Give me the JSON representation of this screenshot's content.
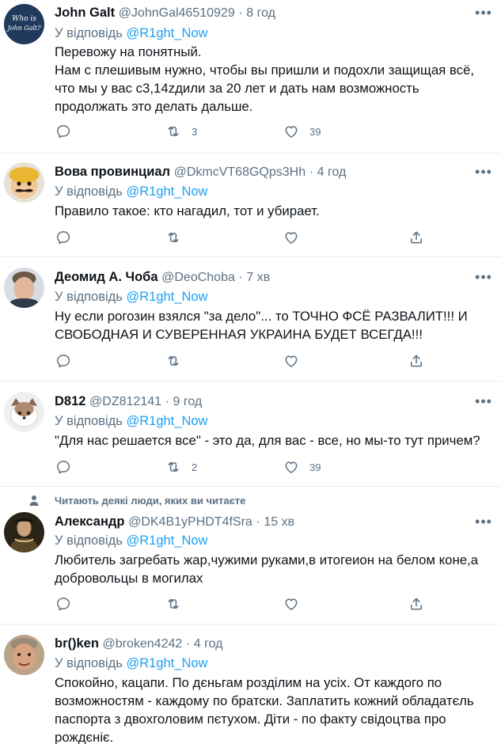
{
  "reply_prefix": "У відповідь ",
  "reply_mention": "@R1ght_Now",
  "dot": "·",
  "social_context": "Читають деякі люди, яких ви читаєте",
  "colors": {
    "accent": "#1da1f2",
    "secondary": "#5b7083",
    "text": "#0f1419",
    "divider": "#e6ecf0"
  },
  "avatar_labels": {
    "t0": "Who is",
    "t0b": "John Galt?"
  },
  "tweets": [
    {
      "name": "John Galt",
      "handle": "@JohnGal46510929",
      "time": "8 год",
      "lines": [
        "Перевожу на понятный.",
        "Нам с плешивым нужно, чтобы вы пришли и подохли защищая всё,",
        "что мы у вас с3,14zдили за 20 лет и дать нам возможность",
        "продолжать это делать дальше."
      ],
      "retweets": "3",
      "likes": "39"
    },
    {
      "name": "Вова провинциал",
      "handle": "@DkmcVT68GQps3Hh",
      "time": "4 год",
      "lines": [
        "Правило такое: кто нагадил, тот и убирает."
      ],
      "retweets": "",
      "likes": ""
    },
    {
      "name": "Деомид А. Чоба",
      "handle": "@DeoChoba",
      "time": "7 хв",
      "lines": [
        "Ну если рогозин взялся \"за дело\"... то ТОЧНО ФСЁ РАЗВАЛИТ!!! И",
        "СВОБОДНАЯ И СУВЕРЕННАЯ УКРАИНА БУДЕТ ВСЕГДА!!!"
      ],
      "retweets": "",
      "likes": ""
    },
    {
      "name": "D812",
      "handle": "@DZ812141",
      "time": "9 год",
      "lines": [
        "\"Для нас решается все\" - это да, для вас - все, но мы-то тут причем?"
      ],
      "retweets": "2",
      "likes": "39"
    },
    {
      "name": "Александр",
      "handle": "@DK4B1yPHDT4fSra",
      "time": "15 хв",
      "lines": [
        "Любитель загребать жар,чужими руками,в итогеион на белом коне,а",
        "добровольцы в могилах"
      ],
      "retweets": "",
      "likes": ""
    },
    {
      "name": "br()ken",
      "handle": "@broken4242",
      "time": "4 год",
      "lines": [
        "Спокойно, кацапи. По дєньгам розділим на усіх. От каждого по",
        "возможностям - каждому по братски. Заплатить кожний обладатєль",
        "паспорта з двохголовим пєтухом. Діти - по факту свідоцтва про",
        "рождєніє."
      ],
      "retweets": "",
      "likes": ""
    }
  ]
}
